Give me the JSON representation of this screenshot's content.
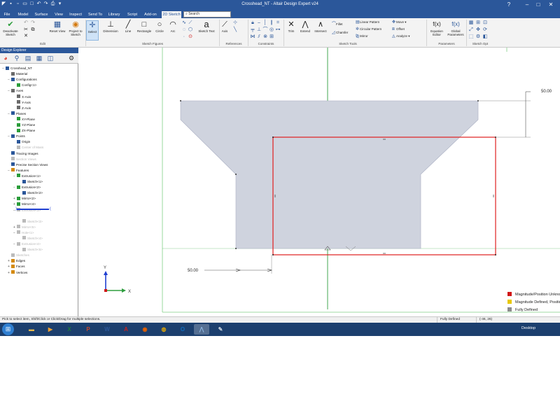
{
  "window": {
    "title": "Crosshead_NT - Altair Design Expert v24"
  },
  "menu": {
    "tabs": [
      "File",
      "Model",
      "Surface",
      "View",
      "Inspect",
      "Send To",
      "Library",
      "Script",
      "Add-on",
      "2D Sketch"
    ],
    "active_tab": "2D Sketch",
    "search_placeholder": "Search"
  },
  "ribbon": {
    "groups": {
      "edit": "Edit",
      "sketch_figures": "Sketch Figures",
      "references": "References",
      "constraints": "Constraints",
      "sketch_tools": "Sketch Tools",
      "parameters": "Parameters",
      "sketch_opt": "Sketch Opt"
    },
    "buttons": {
      "deactivate_sketch": "Deactivate Sketch",
      "reset_view": "Reset View",
      "project_to_sketch": "Project to Sketch",
      "select": "Select",
      "dimension": "Dimension",
      "line": "Line",
      "rectangle": "Rectangle",
      "circle": "Circle",
      "arc": "Arc",
      "sketch_text": "Sketch Text",
      "axis": "Axis",
      "trim": "Trim",
      "extend": "Extend",
      "intersect": "Intersect",
      "fillet": "Fillet",
      "chamfer": "Chamfer",
      "linear_pattern": "Linear Pattern",
      "circular_pattern": "Circular Pattern",
      "mirror": "Mirror",
      "move": "Move",
      "offset": "Offset",
      "analyze": "Analyze",
      "equation_editor": "Equation Editor",
      "global_parameters": "Global Parameters"
    }
  },
  "explorer": {
    "title": "Design Explorer",
    "nodes": [
      {
        "label": "Crosshead_NT",
        "dim": false
      },
      {
        "label": "Material",
        "dim": false
      },
      {
        "label": "Configurations",
        "dim": false
      },
      {
        "label": "Config<1>",
        "dim": false
      },
      {
        "label": "Axes",
        "dim": false
      },
      {
        "label": "X-Axis",
        "dim": false
      },
      {
        "label": "Y-Axis",
        "dim": false
      },
      {
        "label": "Z-Axis",
        "dim": false
      },
      {
        "label": "Planes",
        "dim": false
      },
      {
        "label": "XY-Plane",
        "dim": false
      },
      {
        "label": "YZ-Plane",
        "dim": false
      },
      {
        "label": "ZX-Plane",
        "dim": false
      },
      {
        "label": "Points",
        "dim": false
      },
      {
        "label": "Origin",
        "dim": false
      },
      {
        "label": "Center of Mass",
        "dim": true
      },
      {
        "label": "Tracing Images",
        "dim": false
      },
      {
        "label": "Section Views",
        "dim": true
      },
      {
        "label": "Precise Section Views",
        "dim": false
      },
      {
        "label": "Features",
        "dim": false
      },
      {
        "label": "Extrusion<1>",
        "dim": false
      },
      {
        "label": "Sketch<1>",
        "dim": false
      },
      {
        "label": "Extrusion<2>",
        "dim": false
      },
      {
        "label": "Sketch<2>",
        "dim": false
      },
      {
        "label": "Mirror<2>",
        "dim": false
      },
      {
        "label": "Mirror<4>",
        "dim": false
      },
      {
        "label": "Extrusion<3>",
        "dim": true
      },
      {
        "label": "Sketch<3>",
        "dim": true
      },
      {
        "label": "Mirror<5>",
        "dim": true
      },
      {
        "label": "Hole<1>",
        "dim": true
      },
      {
        "label": "Sketch<4>",
        "dim": true
      },
      {
        "label": "Extrusion<4>",
        "dim": true
      },
      {
        "label": "Sketch<5>",
        "dim": true
      },
      {
        "label": "Sketches",
        "dim": true
      },
      {
        "label": "Edges",
        "dim": false
      },
      {
        "label": "Faces",
        "dim": false
      },
      {
        "label": "Vertices",
        "dim": false
      }
    ]
  },
  "canvas": {
    "dim_top": "50.00",
    "dim_left": "50.00",
    "axis_x": "X",
    "axis_y": "Y"
  },
  "legend": [
    {
      "label": "Magnitude/Position Unknown",
      "color": "#d01818"
    },
    {
      "label": "Magnitude Defined, Position Unknown",
      "color": "#e8c800"
    },
    {
      "label": "Fully Defined",
      "color": "#8c8c8c"
    }
  ],
  "status": {
    "hint": "Pick to select item, Shift/Click or Click/Drag for multiple selections.",
    "state": "Fully Defined",
    "coords": "(-46, 26)"
  },
  "taskbar": {
    "apps": [
      "windows-explorer",
      "media-player",
      "excel",
      "powerpoint",
      "word",
      "acrobat",
      "firefox",
      "chrome",
      "outlook",
      "design-expert",
      "paint"
    ],
    "desktop_label": "Desktop"
  },
  "colors": {
    "accent": "#2b579a",
    "sketch_fill": "#cfd3de",
    "selection_red": "#e01f1f",
    "axis_green": "#2f9e3f"
  }
}
